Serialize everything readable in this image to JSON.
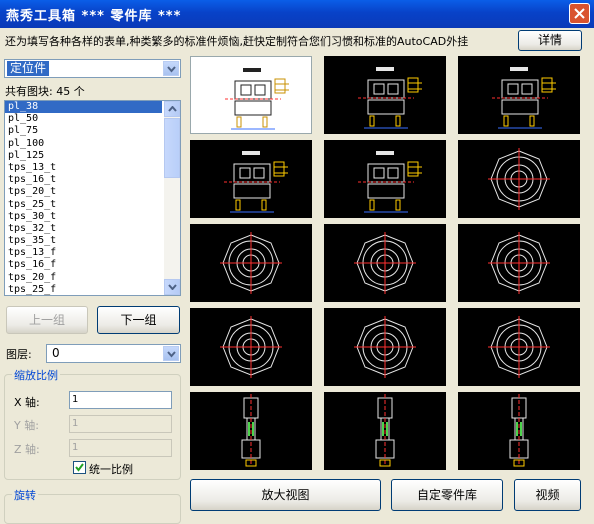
{
  "window": {
    "title": "燕秀工具箱   ***  零件库  ***",
    "notice": "还为填写各种各样的表单,种类繁多的标准件烦恼,赶快定制符合您们习惯和标准的AutoCAD外挂",
    "details_label": "详情"
  },
  "category": {
    "selected": "定位件"
  },
  "block_count_text": "共有图块: 45 个",
  "parts": [
    "pl_38",
    "pl_50",
    "pl_75",
    "pl_100",
    "pl_125",
    "tps_13_t",
    "tps_16_t",
    "tps_20_t",
    "tps_25_t",
    "tps_30_t",
    "tps_32_t",
    "tps_35_t",
    "tps_13_f",
    "tps_16_f",
    "tps_20_f",
    "tps_25_f"
  ],
  "nav": {
    "prev_label": "上一组",
    "next_label": "下一组"
  },
  "layer": {
    "label": "图层:",
    "value": "0"
  },
  "scale": {
    "title": "缩放比例",
    "x_label": "X 轴:",
    "x_value": "1",
    "y_label": "Y 轴:",
    "y_value": "1",
    "z_label": "Z 轴:",
    "z_value": "1",
    "uniform_label": "统一比例",
    "uniform_checked": true
  },
  "rotate": {
    "title": "旋转"
  },
  "preview_tiles": [
    "locating-block",
    "locating-block",
    "locating-block",
    "locating-block",
    "locating-block",
    "round-locator",
    "round-locator",
    "round-locator",
    "round-locator",
    "round-locator",
    "round-locator",
    "round-locator",
    "pin-assembly",
    "pin-assembly",
    "pin-assembly"
  ],
  "buttons": {
    "zoom_label": "放大视图",
    "custom_label": "自定零件库",
    "video_label": "视频"
  }
}
